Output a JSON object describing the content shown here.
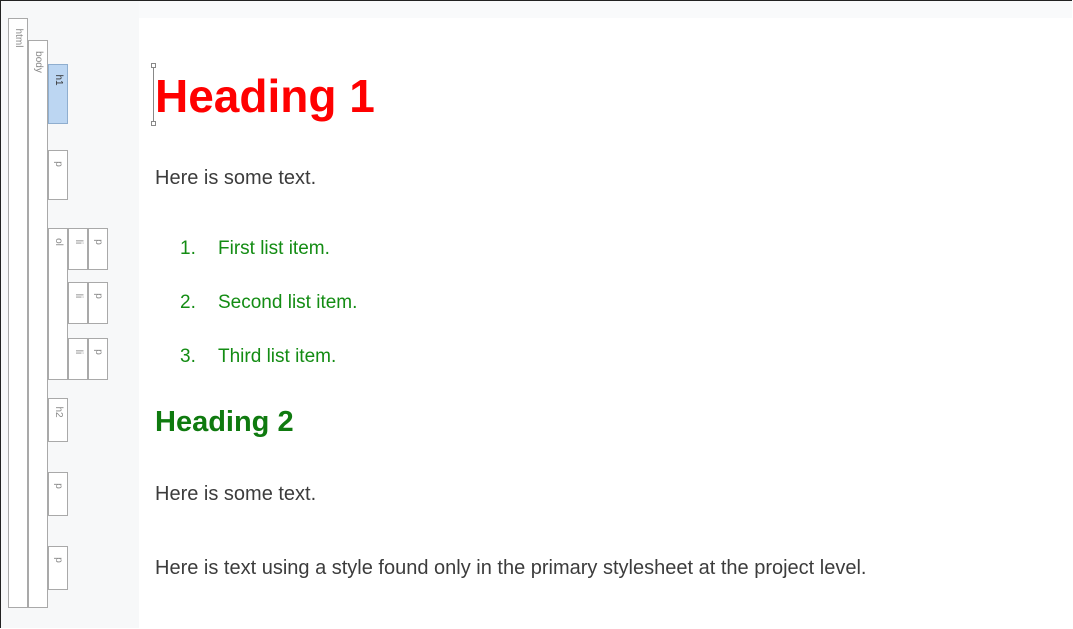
{
  "structure_bar": {
    "html_label": "html",
    "body_label": "body",
    "h1_label": "h1",
    "p_label": "p",
    "ol_label": "ol",
    "li_label": "li",
    "h2_label": "h2"
  },
  "document": {
    "heading1": "Heading 1",
    "para1": "Here is some text.",
    "list": [
      {
        "num": "1.",
        "text": "First list item."
      },
      {
        "num": "2.",
        "text": "Second list item."
      },
      {
        "num": "3.",
        "text": "Third list item."
      }
    ],
    "heading2": "Heading 2",
    "para2": "Here is some text.",
    "para3": "Here is text using a style found only in the primary stylesheet at the project level."
  },
  "colors": {
    "heading1": "#ff0000",
    "heading2": "#0f7a0f",
    "list_text": "#138c13",
    "body_text": "#3c3c3c",
    "selected_tag": "#bcd6f2"
  }
}
